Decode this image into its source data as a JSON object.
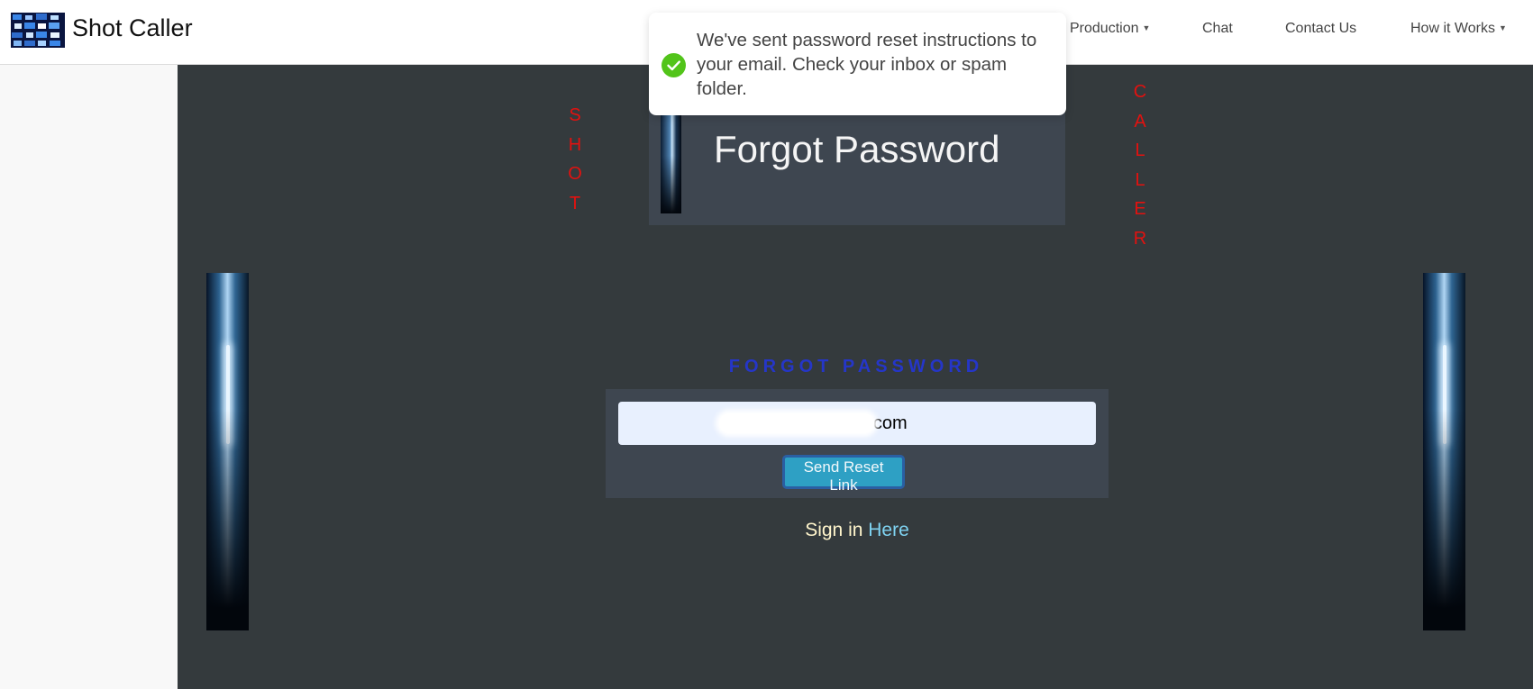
{
  "navbar": {
    "brand": "Shot Caller",
    "items": [
      {
        "label": "Production",
        "has_dropdown": true
      },
      {
        "label": "Chat",
        "has_dropdown": false
      },
      {
        "label": "Contact Us",
        "has_dropdown": false
      },
      {
        "label": "How it Works",
        "has_dropdown": true
      }
    ]
  },
  "toast": {
    "icon": "check-circle-icon",
    "message": "We've sent password reset instructions to your email. Check your inbox or spam folder.",
    "icon_color": "#52c41a"
  },
  "header": {
    "title": "Forgot Password"
  },
  "side_words": {
    "left": [
      "S",
      "H",
      "O",
      "T"
    ],
    "right": [
      "C",
      "A",
      "L",
      "L",
      "E",
      "R"
    ],
    "color": "#e3110f"
  },
  "form": {
    "heading": "FORGOT PASSWORD",
    "email_value": "@gmail.com",
    "submit_label": "Send Reset Link",
    "signin_prefix": "Sign in",
    "signin_link": "Here"
  },
  "colors": {
    "background": "#343a3d",
    "card": "#3e4650",
    "heading": "#2536c8",
    "button": "#2ea0c4",
    "link": "#7fd3f2"
  }
}
